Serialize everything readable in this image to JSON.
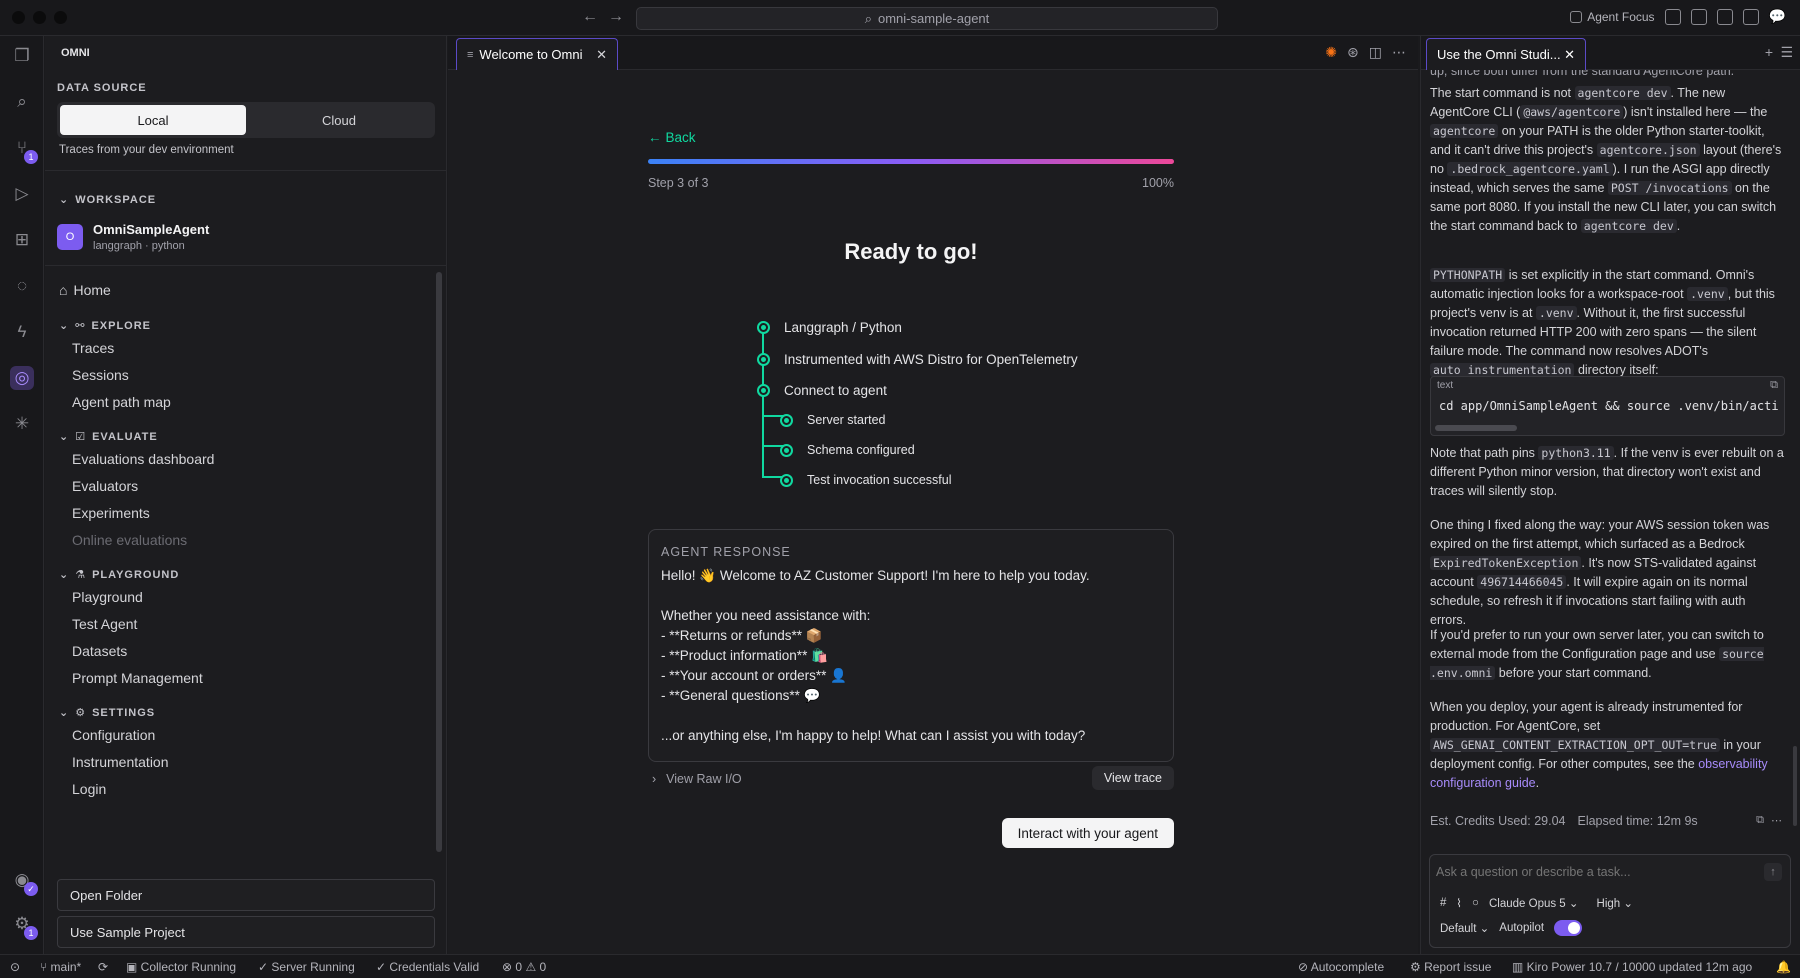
{
  "titlebar": {
    "search": "omni-sample-agent",
    "agent_focus": "Agent Focus"
  },
  "sidebar": {
    "app_title": "OMNI",
    "data_source": {
      "label": "DATA SOURCE",
      "local": "Local",
      "cloud": "Cloud",
      "hint": "Traces from your dev environment"
    },
    "workspace": {
      "label": "WORKSPACE",
      "avatar": "O",
      "name": "OmniSampleAgent",
      "meta": "langgraph · python"
    },
    "home": "Home",
    "explore": {
      "label": "EXPLORE",
      "items": [
        "Traces",
        "Sessions",
        "Agent path map"
      ]
    },
    "evaluate": {
      "label": "EVALUATE",
      "items": [
        "Evaluations dashboard",
        "Evaluators",
        "Experiments",
        "Online evaluations"
      ]
    },
    "playground": {
      "label": "PLAYGROUND",
      "items": [
        "Playground",
        "Test Agent",
        "Datasets",
        "Prompt Management"
      ]
    },
    "settings": {
      "label": "SETTINGS",
      "items": [
        "Configuration",
        "Instrumentation",
        "Login"
      ]
    },
    "open_folder": "Open Folder",
    "use_sample": "Use Sample Project",
    "badges": {
      "source_control": "1",
      "account": "1"
    }
  },
  "editor": {
    "tab_title": "Welcome to Omni",
    "back": "Back",
    "step_label": "Step 3 of 3",
    "progress_pct": "100%",
    "progress": 1.0,
    "heading": "Ready to go!",
    "steps": [
      "Langgraph / Python",
      "Instrumented with AWS Distro for OpenTelemetry",
      "Connect to agent"
    ],
    "substeps": [
      "Server started",
      "Schema configured",
      "Test invocation successful"
    ],
    "response": {
      "label": "AGENT RESPONSE",
      "line1": "Hello! 👋 Welcome to AZ Customer Support! I'm here to help you today.",
      "line2": "Whether you need assistance with:",
      "bullets": [
        "- **Returns or refunds** 📦",
        "- **Product information** 🛍️",
        "- **Your account or orders** 👤",
        "- **General questions** 💬"
      ],
      "line3": "...or anything else, I'm happy to help! What can I assist you with today?"
    },
    "view_raw": "View Raw I/O",
    "view_trace": "View trace",
    "interact": "Interact with your agent"
  },
  "chat": {
    "tab_title": "Use the Omni Studi...",
    "top_cut": "up, since both differ from the standard AgentCore path.",
    "code_label": "text",
    "code": "cd app/OmniSampleAgent && source .venv/bin/activa",
    "p1": {
      "a": "The start command is not ",
      "b": "agentcore dev",
      "c": ". The new AgentCore CLI (",
      "d": "@aws/agentcore",
      "e": ") isn't installed here — the ",
      "f": "agentcore",
      "g": " on your PATH is the older Python starter-toolkit, and it can't drive this project's ",
      "h": "agentcore.json",
      "i": " layout (there's no ",
      "j": ".bedrock_agentcore.yaml",
      "k": "). I run the ASGI app directly instead, which serves the same ",
      "l": "POST /invocations",
      "m": " on the same port 8080. If you install the new CLI later, you can switch the start command back to ",
      "n": "agentcore dev",
      "o": "."
    },
    "p2": {
      "a": "PYTHONPATH",
      "b": " is set explicitly in the start command. Omni's automatic injection looks for a workspace-root ",
      "c": ".venv",
      "d": ", but this project's venv is at ",
      "e": ".venv",
      "f": ". Without it, the first successful invocation returned HTTP 200 with zero spans — the silent failure mode. The command now resolves ADOT's ",
      "g": "auto_instrumentation",
      "h": " directory itself:"
    },
    "p3": {
      "a": "Note that path pins ",
      "b": "python3.11",
      "c": ". If the venv is ever rebuilt on a different Python minor version, that directory won't exist and traces will silently stop."
    },
    "p4": {
      "a": "One thing I fixed along the way: your AWS session token was expired on the first attempt, which surfaced as a Bedrock ",
      "b": "ExpiredTokenException",
      "c": ". It's now STS-validated against account ",
      "d": "496714466045",
      "e": ". It will expire again on its normal schedule, so refresh it if invocations start failing with auth errors."
    },
    "p5": {
      "a": "If you'd prefer to run your own server later, you can switch to external mode from the Configuration page and use ",
      "b": "source .env.omni",
      "c": " before your start command."
    },
    "p6": {
      "a": "When you deploy, your agent is already instrumented for production. For AgentCore, set ",
      "b": "AWS_GENAI_CONTENT_EXTRACTION_OPT_OUT=true",
      "c": " in your deployment config. For other computes, see the ",
      "d": "observability configuration guide",
      "e": "."
    },
    "credits": "Est. Credits Used: 29.04",
    "elapsed": "Elapsed time: 12m 9s",
    "input_placeholder": "Ask a question or describe a task...",
    "model": "Claude Opus 5",
    "effort": "High",
    "mode": "Default",
    "autopilot": "Autopilot"
  },
  "status": {
    "branch": "main*",
    "collector": "Collector Running",
    "server": "Server Running",
    "creds": "Credentials Valid",
    "errors": "0",
    "warnings": "0",
    "autocomplete": "Autocomplete",
    "report": "Report issue",
    "power": "Kiro Power 10.7 / 10000 updated 12m ago"
  },
  "colors": {
    "accent": "#7c5cf0",
    "success": "#10d9a0",
    "link": "#a78bfa"
  }
}
